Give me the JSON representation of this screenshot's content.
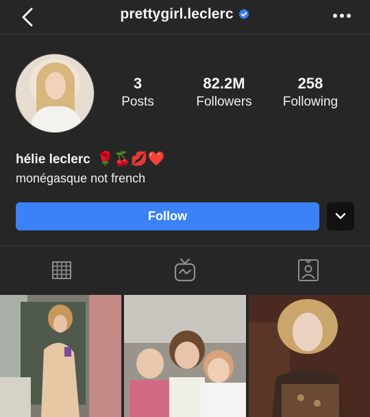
{
  "header": {
    "username": "prettygirl.leclerc",
    "verified": true,
    "verified_color": "#3b82f6"
  },
  "profile": {
    "stats": [
      {
        "value": "3",
        "label": "Posts"
      },
      {
        "value": "82.2M",
        "label": "Followers"
      },
      {
        "value": "258",
        "label": "Following"
      }
    ],
    "display_name": "hélie leclerc",
    "name_emojis": "🌹🍒💋❤️",
    "bio": "monégasque not french"
  },
  "actions": {
    "follow_label": "Follow",
    "follow_color": "#3b82f6"
  },
  "tabs": [
    {
      "icon": "grid-icon"
    },
    {
      "icon": "igtv-icon"
    },
    {
      "icon": "tagged-icon"
    }
  ],
  "posts": [
    {
      "icon": "photo-thumbnail"
    },
    {
      "icon": "photo-thumbnail"
    },
    {
      "icon": "photo-thumbnail"
    }
  ]
}
